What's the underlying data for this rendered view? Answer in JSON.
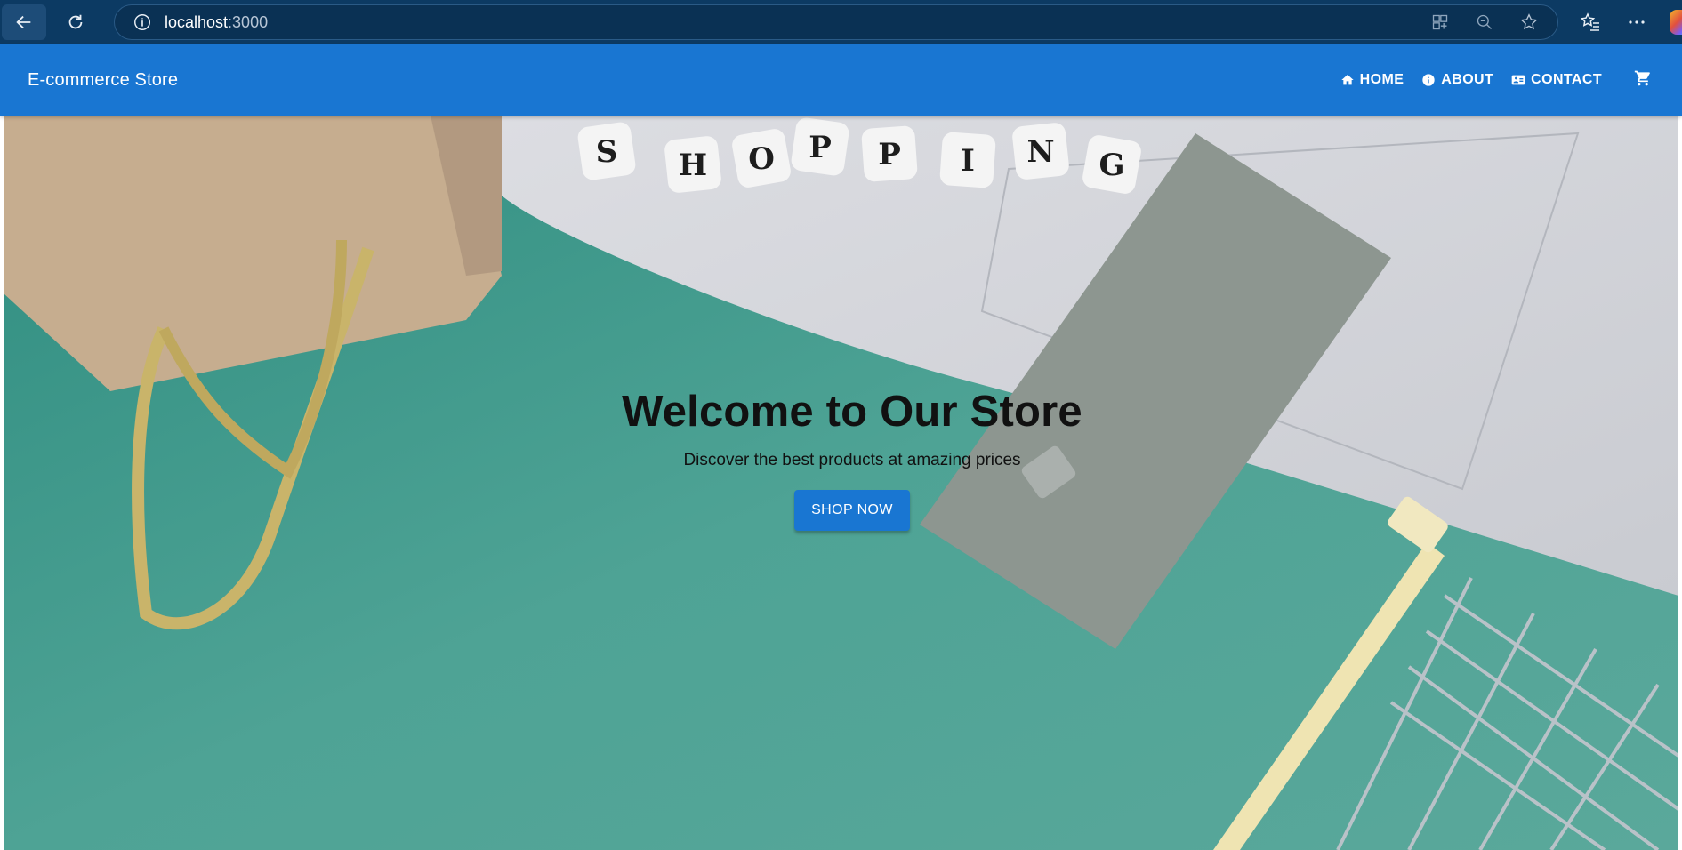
{
  "browser": {
    "url_host": "localhost",
    "url_port": ":3000"
  },
  "app": {
    "brand": "E-commerce Store",
    "nav": [
      {
        "label": "HOME",
        "icon": "home-icon"
      },
      {
        "label": "ABOUT",
        "icon": "info-icon"
      },
      {
        "label": "CONTACT",
        "icon": "contact-card-icon"
      }
    ],
    "cart_icon": "shopping-cart-icon",
    "accent": "#1976d2"
  },
  "hero": {
    "title": "Welcome to Our Store",
    "subtitle": "Discover the best products at amazing prices",
    "cta": "SHOP NOW",
    "background": "shopping-photo",
    "cube_letters": [
      "S",
      "H",
      "O",
      "P",
      "P",
      "I",
      "N",
      "G"
    ]
  }
}
